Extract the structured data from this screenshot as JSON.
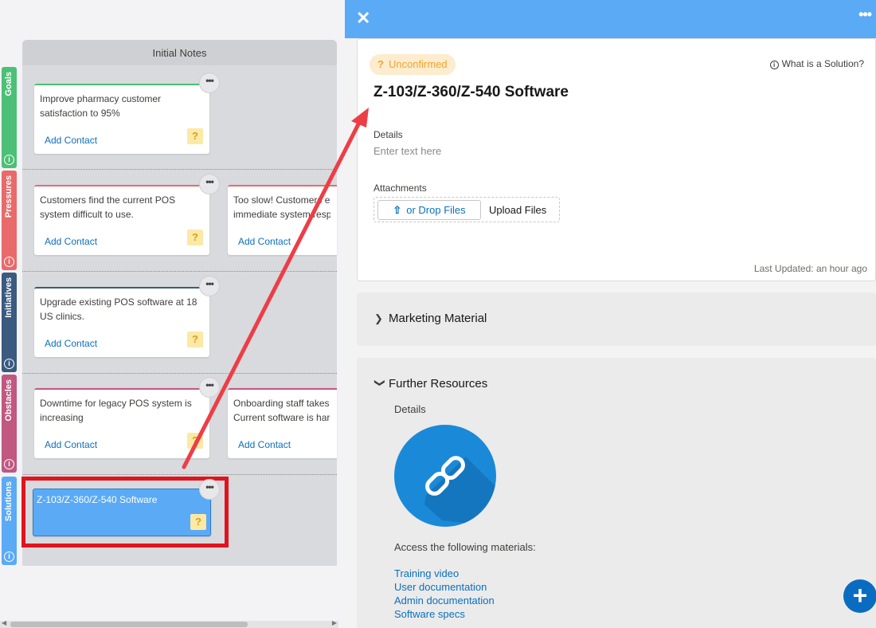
{
  "board": {
    "column_title": "Initial Notes",
    "lanes": [
      {
        "label": "Goals",
        "color": "#4bc076"
      },
      {
        "label": "Pressures",
        "color": "#e96a6a"
      },
      {
        "label": "Initiatives",
        "color": "#3a5a80"
      },
      {
        "label": "Obstacles",
        "color": "#c05881"
      },
      {
        "label": "Solutions",
        "color": "#5aaaf5"
      }
    ],
    "cards": [
      {
        "text": "Improve pharmacy customer\nsatisfaction to 95%",
        "link": "Add Contact",
        "badge": "?"
      },
      {
        "text": "Customers find the current POS\nsystem difficult to use.",
        "link": "Add Contact",
        "badge": "?"
      },
      {
        "text": "Too slow! Customers ex\nimmediate system respo",
        "link": "Add Contact"
      },
      {
        "text": "Upgrade existing POS software at 18\nUS clinics.",
        "link": "Add Contact",
        "badge": "?"
      },
      {
        "text": "Downtime for legacy POS system is\nincreasing",
        "link": "Add Contact",
        "badge": "?"
      },
      {
        "text": "Onboarding staff takes t\nCurrent software is hard",
        "link": "Add Contact"
      },
      {
        "text": "Z-103/Z-360/Z-540 Software",
        "badge": "?"
      }
    ],
    "more_glyph": "•••"
  },
  "panel": {
    "close_glyph": "✕",
    "more_glyph": "•••",
    "status": "Unconfirmed",
    "status_glyph": "?",
    "help_link": "What is a Solution?",
    "title": "Z-103/Z-360/Z-540 Software",
    "details_label": "Details",
    "details_placeholder": "Enter text here",
    "attachments_label": "Attachments",
    "upload_button": "or Drop Files",
    "upload_files": "Upload Files",
    "last_updated": "Last Updated: an hour ago",
    "sections": {
      "marketing": "Marketing Material",
      "further": "Further Resources"
    },
    "further": {
      "details_label": "Details",
      "icon": "link-icon",
      "access_text": "Access the following materials:",
      "links": [
        "Training video",
        "User documentation",
        "Admin documentation",
        "Software specs"
      ]
    },
    "fab_glyph": "+"
  },
  "colors": {
    "header_blue": "#5aaaf5",
    "link_blue": "#0b6fbf",
    "highlight_red": "#e0141e",
    "arrow_red": "#ee3d46"
  }
}
